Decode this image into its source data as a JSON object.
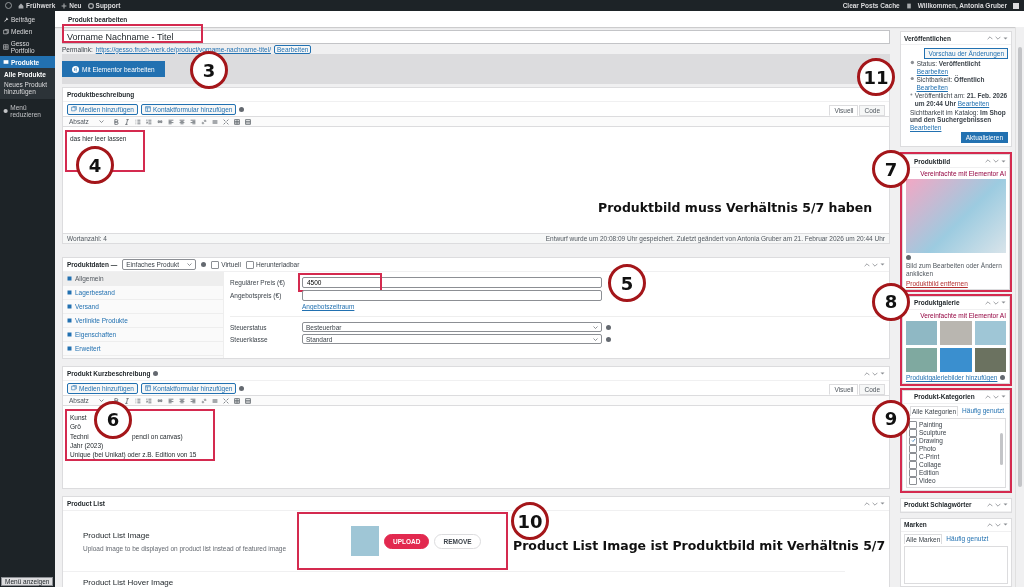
{
  "admin_bar": {
    "items": [
      "Frühwerk",
      "Neu",
      "Support"
    ],
    "right_items": [
      "Clear Posts Cache",
      "Willkommen, Antonia Gruber"
    ]
  },
  "sidebar": {
    "items": [
      {
        "label": "Beiträge",
        "selected": false
      },
      {
        "label": "Medien",
        "selected": false
      },
      {
        "label": "Gesso Portfolio",
        "selected": false
      },
      {
        "label": "Produkte",
        "selected": true,
        "children": [
          {
            "label": "Alle Produkte",
            "selected": true
          },
          {
            "label": "Neues Produkt hinzufügen",
            "selected": false
          }
        ]
      }
    ],
    "collapse": "Menü reduzieren",
    "show_menu_button": "Menü anzeigen"
  },
  "page_title": "Produkt bearbeiten",
  "title_field": {
    "value": "Vorname Nachname - Titel"
  },
  "permalink": {
    "label": "Permalink:",
    "url": "https://gesso.fruch-werk.de/product/vorname-nachname-titel/",
    "button": "Bearbeiten"
  },
  "elementor_button": "Mit Elementor bearbeiten",
  "description": {
    "title": "Produktbeschreibung",
    "media_buttons": [
      "Medien hinzufügen",
      "Kontaktformular hinzufügen"
    ],
    "tabs": [
      {
        "label": "Visuell",
        "selected": true
      },
      {
        "label": "Code",
        "selected": false
      }
    ],
    "format": "Absatz",
    "content": "das hier leer lassen",
    "word_count": "Wortanzahl: 4",
    "save_note": "Entwurf wurde um 20:08:09 Uhr gespeichert. Zuletzt geändert von Antonia Gruber am 21. Februar 2026 um 20:44 Uhr"
  },
  "product_data": {
    "title": "Produktdaten —",
    "type": "Einfaches Produkt",
    "options": [
      {
        "label": "Virtuell",
        "checked": false
      },
      {
        "label": "Herunterladbar",
        "checked": false
      }
    ],
    "tabs": [
      {
        "label": "Allgemein",
        "selected": true
      },
      {
        "label": "Lagerbestand",
        "selected": false
      },
      {
        "label": "Versand",
        "selected": false
      },
      {
        "label": "Verlinkte Produkte",
        "selected": false
      },
      {
        "label": "Eigenschaften",
        "selected": false
      },
      {
        "label": "Erweitert",
        "selected": false
      }
    ],
    "fields": [
      {
        "kind": "input",
        "label": "Regulärer Preis (€)",
        "value": "4500"
      },
      {
        "kind": "input",
        "label": "Angebotspreis (€)",
        "link": "Angebotszeitraum"
      },
      {
        "kind": "select",
        "label": "Steuerstatus",
        "value": "Besteuerbar"
      },
      {
        "kind": "select",
        "label": "Steuerklasse",
        "value": "Standard"
      }
    ]
  },
  "short_description": {
    "title": "Produkt Kurzbeschreibung",
    "media_buttons": [
      "Medien hinzufügen",
      "Kontaktformular hinzufügen"
    ],
    "tabs": [
      {
        "label": "Visuell",
        "selected": true
      },
      {
        "label": "Code",
        "selected": false
      }
    ],
    "format": "Absatz",
    "lines": [
      {
        "text": "Kunst"
      },
      {
        "text": "Grö"
      },
      {
        "text": "Techni",
        "after": "pencil on canvas)"
      },
      {
        "text": "Jahr (2023)"
      },
      {
        "text": "Unique (bei Unikat) oder z.B. Edition von 15"
      }
    ]
  },
  "product_list": {
    "title": "Product List",
    "fields": [
      {
        "label": "Product List Image",
        "description": "Upload image to be displayed on product list instead of featured image",
        "image": true,
        "buttons": [
          "UPLOAD",
          "REMOVE"
        ]
      },
      {
        "label": "Product List Hover Image",
        "image": false
      }
    ]
  },
  "publish": {
    "title": "Veröffentlichen",
    "preview_button": "Vorschau der Änderungen",
    "rows": [
      {
        "text": "Status: **Veröffentlicht**",
        "link": "Bearbeiten"
      },
      {
        "text": "Sichtbarkeit: **Öffentlich**",
        "link": "Bearbeiten"
      },
      {
        "text": "Veröffentlicht am: **21. Feb. 2026 um 20:44 Uhr**",
        "link": "Bearbeiten"
      },
      {
        "text": "Sichtbarkeit im Katalog: **Im Shop und den Suchergebnissen**",
        "link": "Bearbeiten"
      }
    ],
    "update_button": "Aktualisieren"
  },
  "featured_image": {
    "title": "Produktbild",
    "ai_link": "Vereinfachte mit Elementor AI",
    "hint": "Bild zum Bearbeiten oder Ändern anklicken",
    "remove_link": "Produktbild entfernen"
  },
  "gallery": {
    "title": "Produktgalerie",
    "ai_link": "Vereinfachte mit Elementor AI",
    "add_link": "Produktgaleriebilder hinzufügen"
  },
  "categories": {
    "title": "Produkt-Kategorien",
    "tabs": [
      {
        "label": "Alle Kategorien",
        "selected": true
      },
      {
        "label": "Häufig genutzt",
        "selected": false
      }
    ],
    "items": [
      {
        "label": "Painting",
        "checked": false
      },
      {
        "label": "Sculpture",
        "checked": false
      },
      {
        "label": "Drawing",
        "checked": true
      },
      {
        "label": "Photo",
        "checked": false
      },
      {
        "label": "C-Print",
        "checked": false
      },
      {
        "label": "Collage",
        "checked": false
      },
      {
        "label": "Edition",
        "checked": false
      },
      {
        "label": "Video",
        "checked": false
      }
    ]
  },
  "tags_box": {
    "title": "Produkt Schlagwörter"
  },
  "brands": {
    "title": "Marken",
    "tabs": [
      {
        "label": "Alle Marken",
        "selected": true
      },
      {
        "label": "Häufig genutzt",
        "selected": false
      }
    ]
  },
  "annotations": {
    "markers": [
      "3",
      "4",
      "5",
      "6",
      "7",
      "8",
      "9",
      "10",
      "11"
    ],
    "notes": [
      "Produktbild muss Verhältnis 5/7 haben",
      "Product List Image ist Produktbild mit Verhältnis 5/7"
    ]
  }
}
